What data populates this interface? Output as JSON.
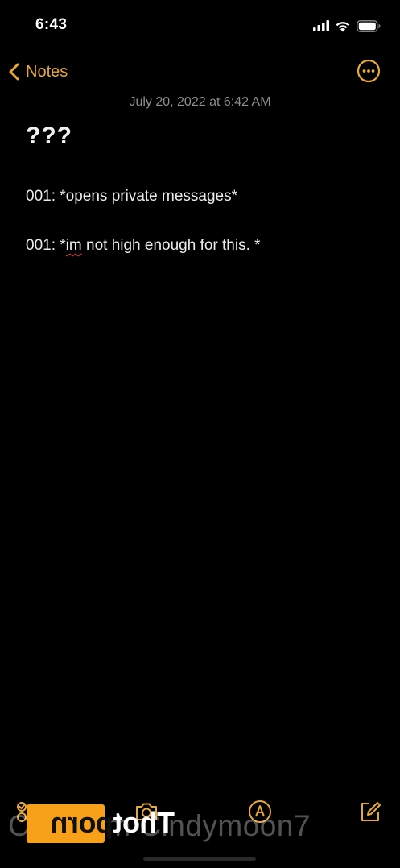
{
  "status_bar": {
    "time": "6:43"
  },
  "nav": {
    "back_label": "Notes"
  },
  "note": {
    "date": "July 20, 2022 at 6:42 AM",
    "title": "???",
    "lines": [
      {
        "text": "001: *opens private messages*"
      },
      {
        "prefix": "001: *",
        "misspelled": "im",
        "suffix": " not high enough for this. *"
      }
    ]
  },
  "watermark": {
    "text": "Clip from Cindymoon7",
    "logo_light": "Thot",
    "logo_dark": "porn"
  },
  "colors": {
    "accent": "#e8a93a",
    "background": "#000000",
    "secondary_text": "#8e8e93",
    "spellcheck": "#e0403a"
  },
  "icons": {
    "back": "chevron-left-icon",
    "more": "ellipsis-circle-icon",
    "checklist": "checklist-icon",
    "camera": "camera-icon",
    "markup": "markup-pen-icon",
    "compose": "compose-icon"
  }
}
